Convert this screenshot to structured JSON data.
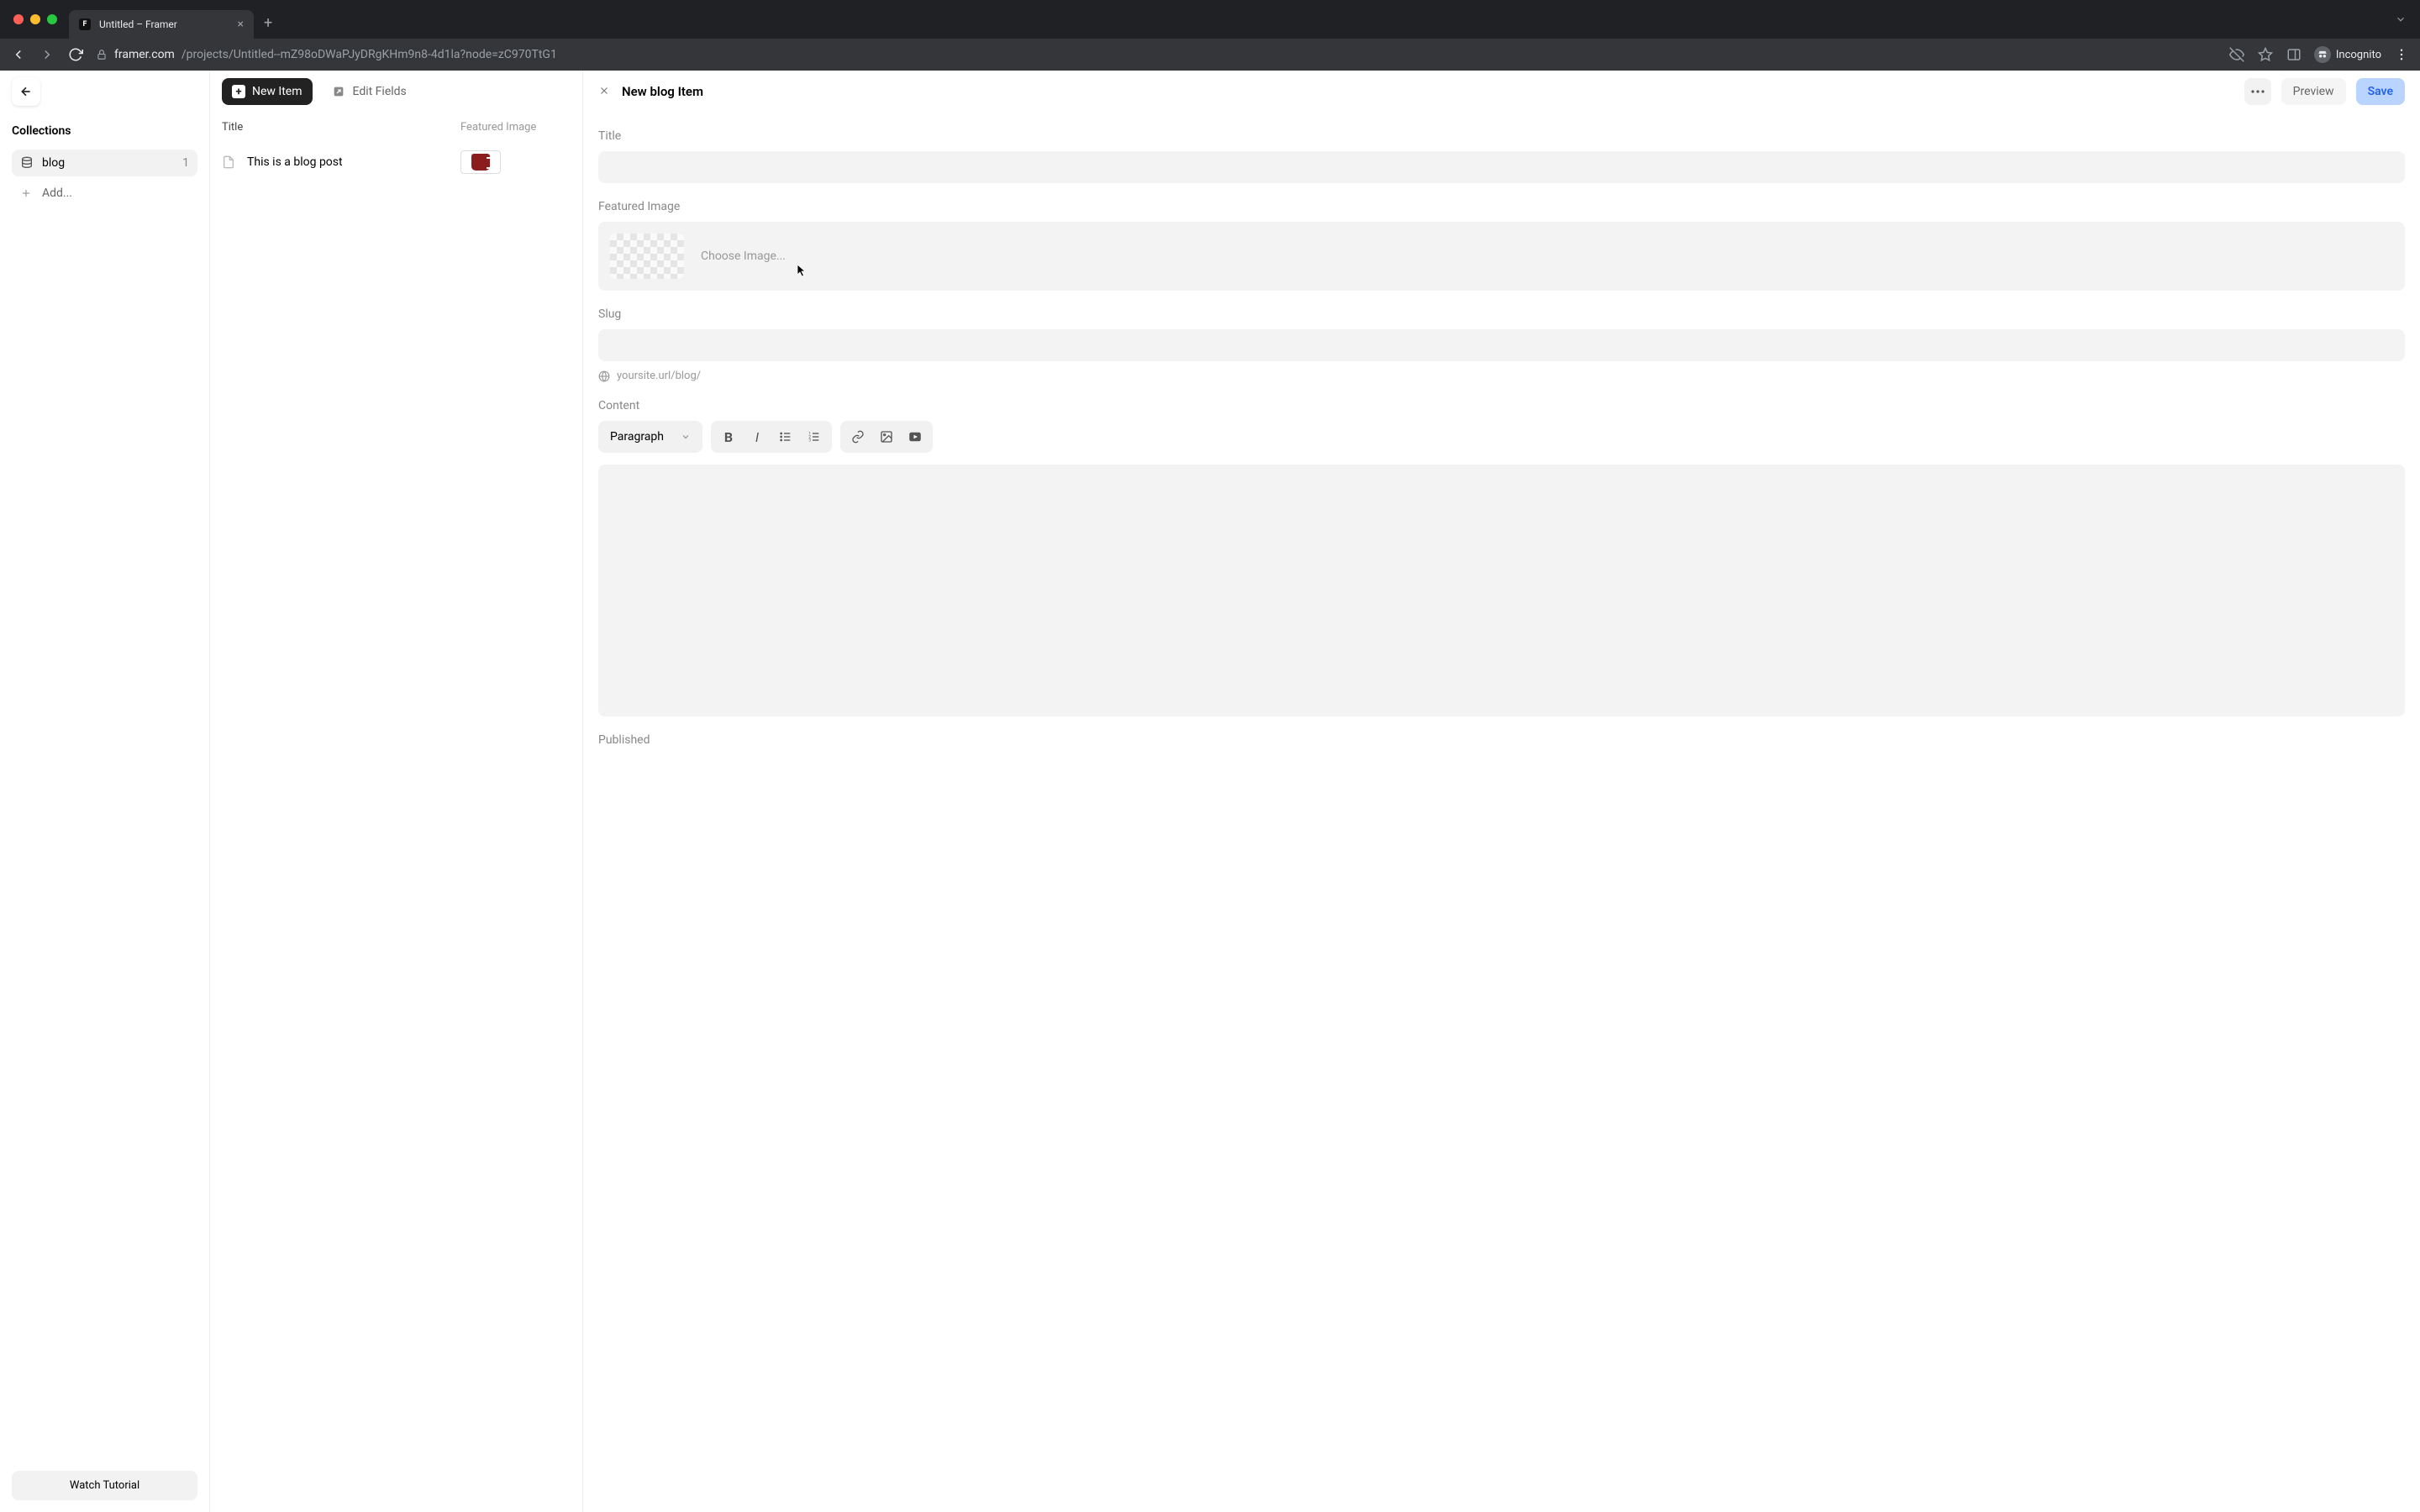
{
  "browser": {
    "tab_title": "Untitled – Framer",
    "url_host": "framer.com",
    "url_path": "/projects/Untitled--mZ98oDWaPJyDRgKHm9n8-4d1la?node=zC970TtG1",
    "incognito_label": "Incognito"
  },
  "toolbar": {
    "new_item": "New Item",
    "edit_fields": "Edit Fields"
  },
  "sidebar": {
    "heading": "Collections",
    "items": [
      {
        "icon": "database-icon",
        "label": "blog",
        "count": "1"
      }
    ],
    "add_label": "Add...",
    "tutorial": "Watch Tutorial"
  },
  "table": {
    "columns": {
      "title": "Title",
      "featured": "Featured Image"
    },
    "rows": [
      {
        "title": "This is a blog post"
      }
    ]
  },
  "detail": {
    "header": "New blog Item",
    "preview": "Preview",
    "save": "Save",
    "fields": {
      "title_label": "Title",
      "title_value": "",
      "featured_label": "Featured Image",
      "choose_image": "Choose Image...",
      "slug_label": "Slug",
      "slug_value": "",
      "slug_url": "yoursite.url/blog/",
      "content_label": "Content",
      "para_select": "Paragraph",
      "published_label": "Published"
    }
  }
}
